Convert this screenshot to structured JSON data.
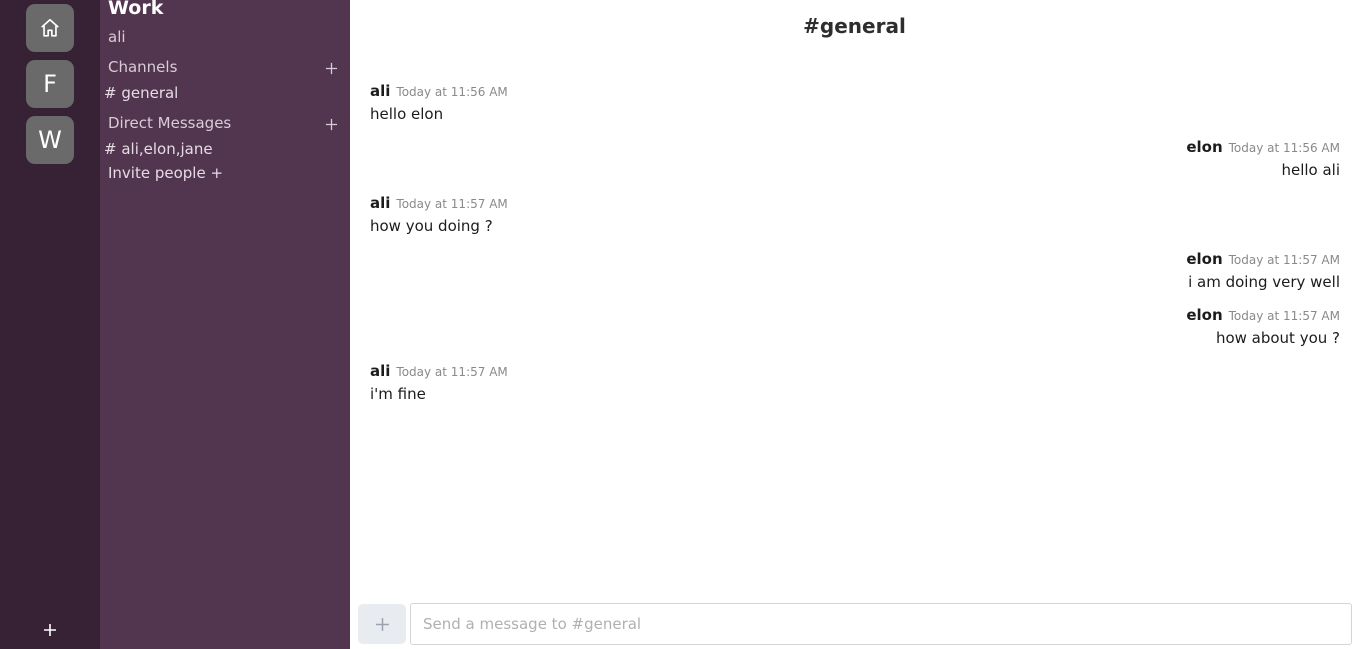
{
  "rail": {
    "workspaces": [
      {
        "initial": "F"
      },
      {
        "initial": "W"
      }
    ],
    "add_label": "+"
  },
  "sidebar": {
    "team_name": "Work",
    "user_name": "ali",
    "channels_title": "Channels",
    "channels": [
      "# general"
    ],
    "dms_title": "Direct Messages",
    "dms": [
      "# ali,elon,jane"
    ],
    "invite_label": "Invite people +"
  },
  "channel": {
    "title": "#general"
  },
  "messages": [
    {
      "author": "ali",
      "time": "Today at 11:56 AM",
      "text": "hello elon",
      "align": "left"
    },
    {
      "author": "elon",
      "time": "Today at 11:56 AM",
      "text": "hello ali",
      "align": "right"
    },
    {
      "author": "ali",
      "time": "Today at 11:57 AM",
      "text": "how you doing ?",
      "align": "left"
    },
    {
      "author": "elon",
      "time": "Today at 11:57 AM",
      "text": "i am doing very well",
      "align": "right"
    },
    {
      "author": "elon",
      "time": "Today at 11:57 AM",
      "text": "how about you ?",
      "align": "right"
    },
    {
      "author": "ali",
      "time": "Today at 11:57 AM",
      "text": "i'm fine",
      "align": "left"
    }
  ],
  "composer": {
    "placeholder": "Send a message to #general",
    "value": ""
  },
  "colors": {
    "rail": "#362234",
    "sidebar": "#52364f",
    "workspace_button": "#6a6a6a"
  }
}
